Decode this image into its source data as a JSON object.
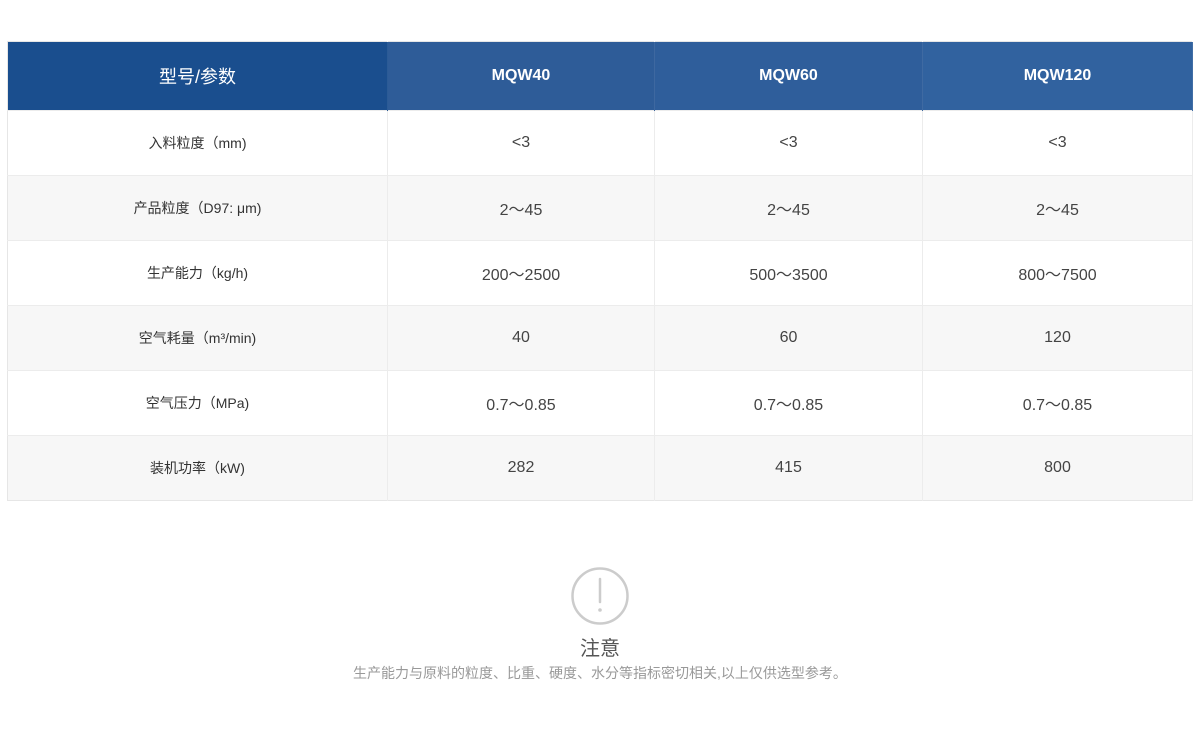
{
  "table": {
    "headers": [
      "型号/参数",
      "MQW40",
      "MQW60",
      "MQW120"
    ],
    "rows": [
      [
        "入料粒度（mm)",
        "<3",
        "<3",
        "<3"
      ],
      [
        "产品粒度（D97: μm)",
        "2～45",
        "2～45",
        "2～45"
      ],
      [
        "生产能力（kg/h)",
        "200～2500",
        "500～3500",
        "800～7500"
      ],
      [
        "空气耗量（m³/min)",
        "40",
        "60",
        "120"
      ],
      [
        "空气压力（MPa)",
        "0.7～0.85",
        "0.7～0.85",
        "0.7～0.85"
      ],
      [
        "装机功率（kW)",
        "282",
        "415",
        "800"
      ]
    ]
  },
  "notice": {
    "icon": "exclamation-circle-icon",
    "title": "注意",
    "text": "生产能力与原料的粒度、比重、硬度、水分等指标密切相关,以上仅供选型参考。"
  },
  "colors": {
    "header_first": "#1a4e8e",
    "header": "#2f5f9c",
    "row_alt": "#f7f7f7",
    "icon": "#cccccc"
  }
}
